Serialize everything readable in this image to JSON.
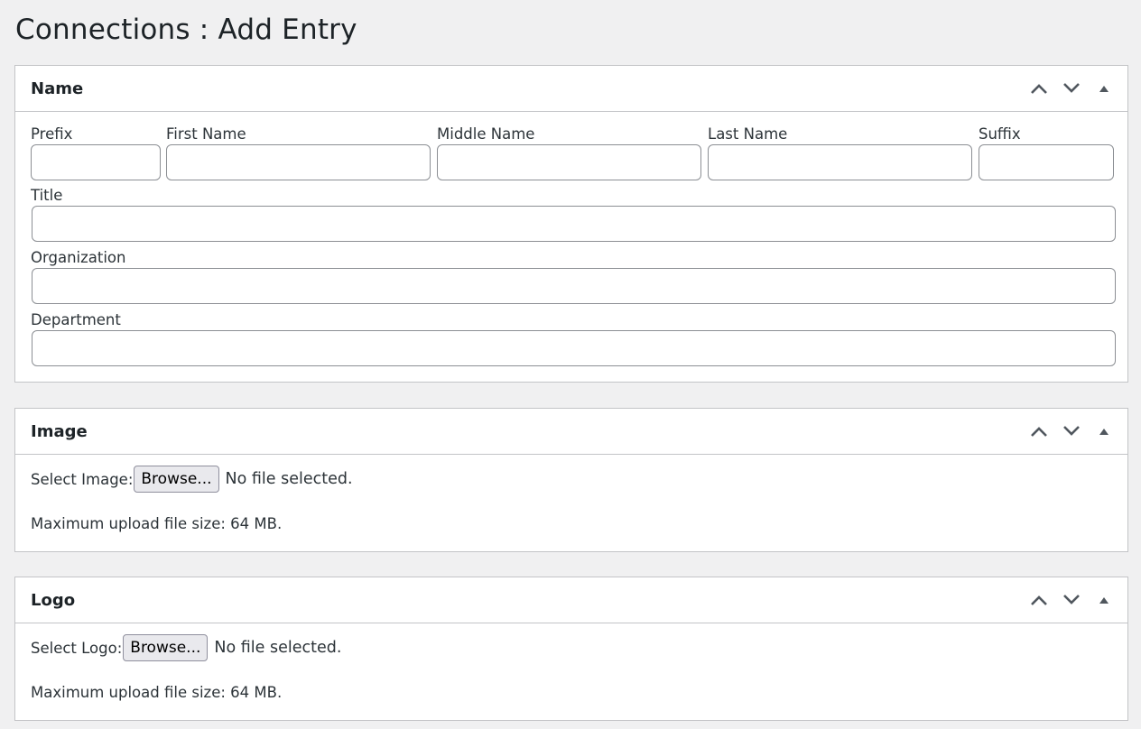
{
  "page": {
    "title": "Connections : Add Entry"
  },
  "icons": {
    "move_up": "chevron-up-icon",
    "move_down": "chevron-down-icon",
    "toggle": "triangle-up-icon"
  },
  "name_box": {
    "title": "Name",
    "prefix_label": "Prefix",
    "first_name_label": "First Name",
    "middle_name_label": "Middle Name",
    "last_name_label": "Last Name",
    "suffix_label": "Suffix",
    "title_label": "Title",
    "organization_label": "Organization",
    "department_label": "Department"
  },
  "image_box": {
    "title": "Image",
    "select_label": "Select Image:",
    "browse_label": "Browse...",
    "no_file_text": "No file selected.",
    "max_size_text": "Maximum upload file size: 64 MB."
  },
  "logo_box": {
    "title": "Logo",
    "select_label": "Select Logo:",
    "browse_label": "Browse...",
    "no_file_text": "No file selected.",
    "max_size_text": "Maximum upload file size: 64 MB."
  }
}
